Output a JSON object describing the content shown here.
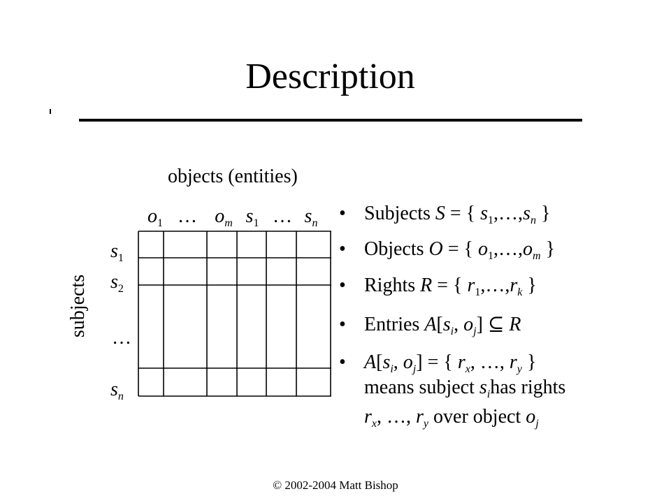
{
  "slide": {
    "title": "Description",
    "footer": "© 2002-2004 Matt Bishop"
  },
  "matrix": {
    "objects_caption": "objects (entities)",
    "subjects_caption": "subjects",
    "column_labels": [
      {
        "base": "o",
        "sub": "1"
      },
      {
        "ellipsis": "…"
      },
      {
        "base": "o",
        "sub": "m"
      },
      {
        "base": "s",
        "sub": "1"
      },
      {
        "ellipsis": "…"
      },
      {
        "base": "s",
        "sub": "n"
      }
    ],
    "row_labels": [
      {
        "base": "s",
        "sub": "1"
      },
      {
        "base": "s",
        "sub": "2"
      },
      {
        "ellipsis": "…"
      },
      {
        "base": "s",
        "sub": "n"
      }
    ]
  },
  "bullets": {
    "marker": "•",
    "subjects": {
      "word": "Subjects",
      "sym": "S",
      "eq": "= {",
      "e1": "s",
      "s1": "1",
      "mid": ",…,",
      "e2": "s",
      "s2": "n",
      "close": "}"
    },
    "objects": {
      "word": "Objects",
      "sym": "O",
      "eq": "= {",
      "e1": "o",
      "s1": "1",
      "mid": ",…,",
      "e2": "o",
      "s2": "m",
      "close": "}"
    },
    "rights": {
      "word": "Rights",
      "sym": "R",
      "eq": "= {",
      "e1": "r",
      "s1": "1",
      "mid": ",…,",
      "e2": "r",
      "s2": "k",
      "close": "}"
    },
    "entries": {
      "word": "Entries",
      "sym": "A",
      "open": "[",
      "e1": "s",
      "s1": "i",
      "comma": ",",
      "e2": "o",
      "s2": "j",
      "close": "]",
      "subset": "⊆",
      "rhs": "R"
    },
    "meaning": {
      "sym": "A",
      "open": "[",
      "e1": "s",
      "s1": "i",
      "comma": ",",
      "e2": "o",
      "s2": "j",
      "close": "] = {",
      "r1": "r",
      "rs1": "x",
      "mid": ", …,",
      "r2": "r",
      "rs2": "y",
      "brace": "}",
      "line2_pre": "means subject",
      "line2_sym": "s",
      "line2_sub": "i",
      "line2_post": "has rights",
      "line3_r1": "r",
      "line3_s1": "x",
      "line3_mid": ", …,",
      "line3_r2": "r",
      "line3_s2": "y",
      "line3_post": "over object",
      "line3_o": "o",
      "line3_osub": "j"
    }
  }
}
